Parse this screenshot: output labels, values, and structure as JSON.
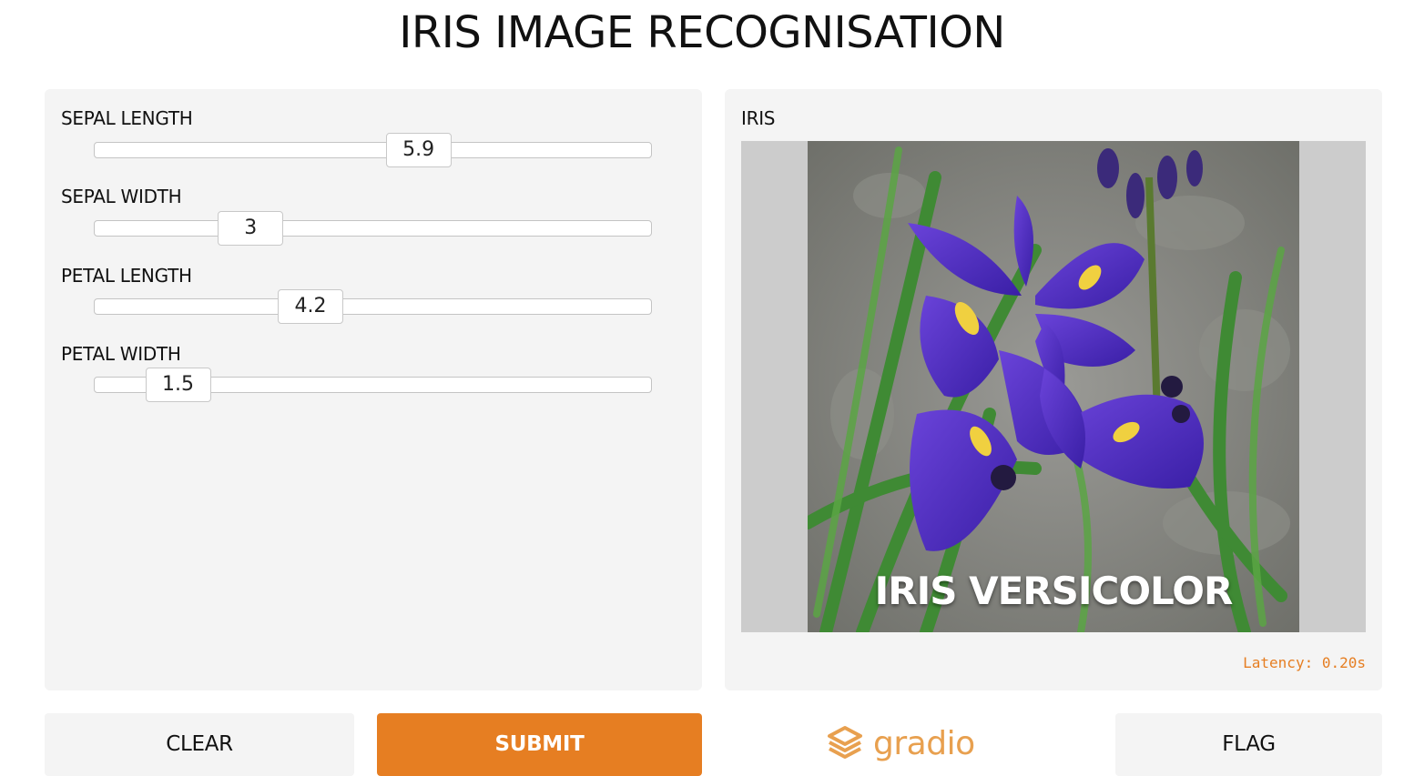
{
  "page": {
    "title": "IRIS IMAGE RECOGNISATION"
  },
  "inputs": {
    "sliders": [
      {
        "label": "SEPAL LENGTH",
        "value": "5.9",
        "fraction": 0.593
      },
      {
        "label": "SEPAL WIDTH",
        "value": "3",
        "fraction": 0.251
      },
      {
        "label": "PETAL LENGTH",
        "value": "4.2",
        "fraction": 0.373
      },
      {
        "label": "PETAL WIDTH",
        "value": "1.5",
        "fraction": 0.103
      }
    ]
  },
  "output": {
    "label": "IRIS",
    "image_caption": "IRIS VERSICOLOR",
    "latency": "Latency: 0.20s"
  },
  "buttons": {
    "clear": "CLEAR",
    "submit": "SUBMIT",
    "flag": "FLAG"
  },
  "branding": {
    "logo_text": "gradio"
  },
  "colors": {
    "accent": "#e67e22",
    "panel_bg": "#f4f4f4",
    "logo": "#e8a04f"
  }
}
